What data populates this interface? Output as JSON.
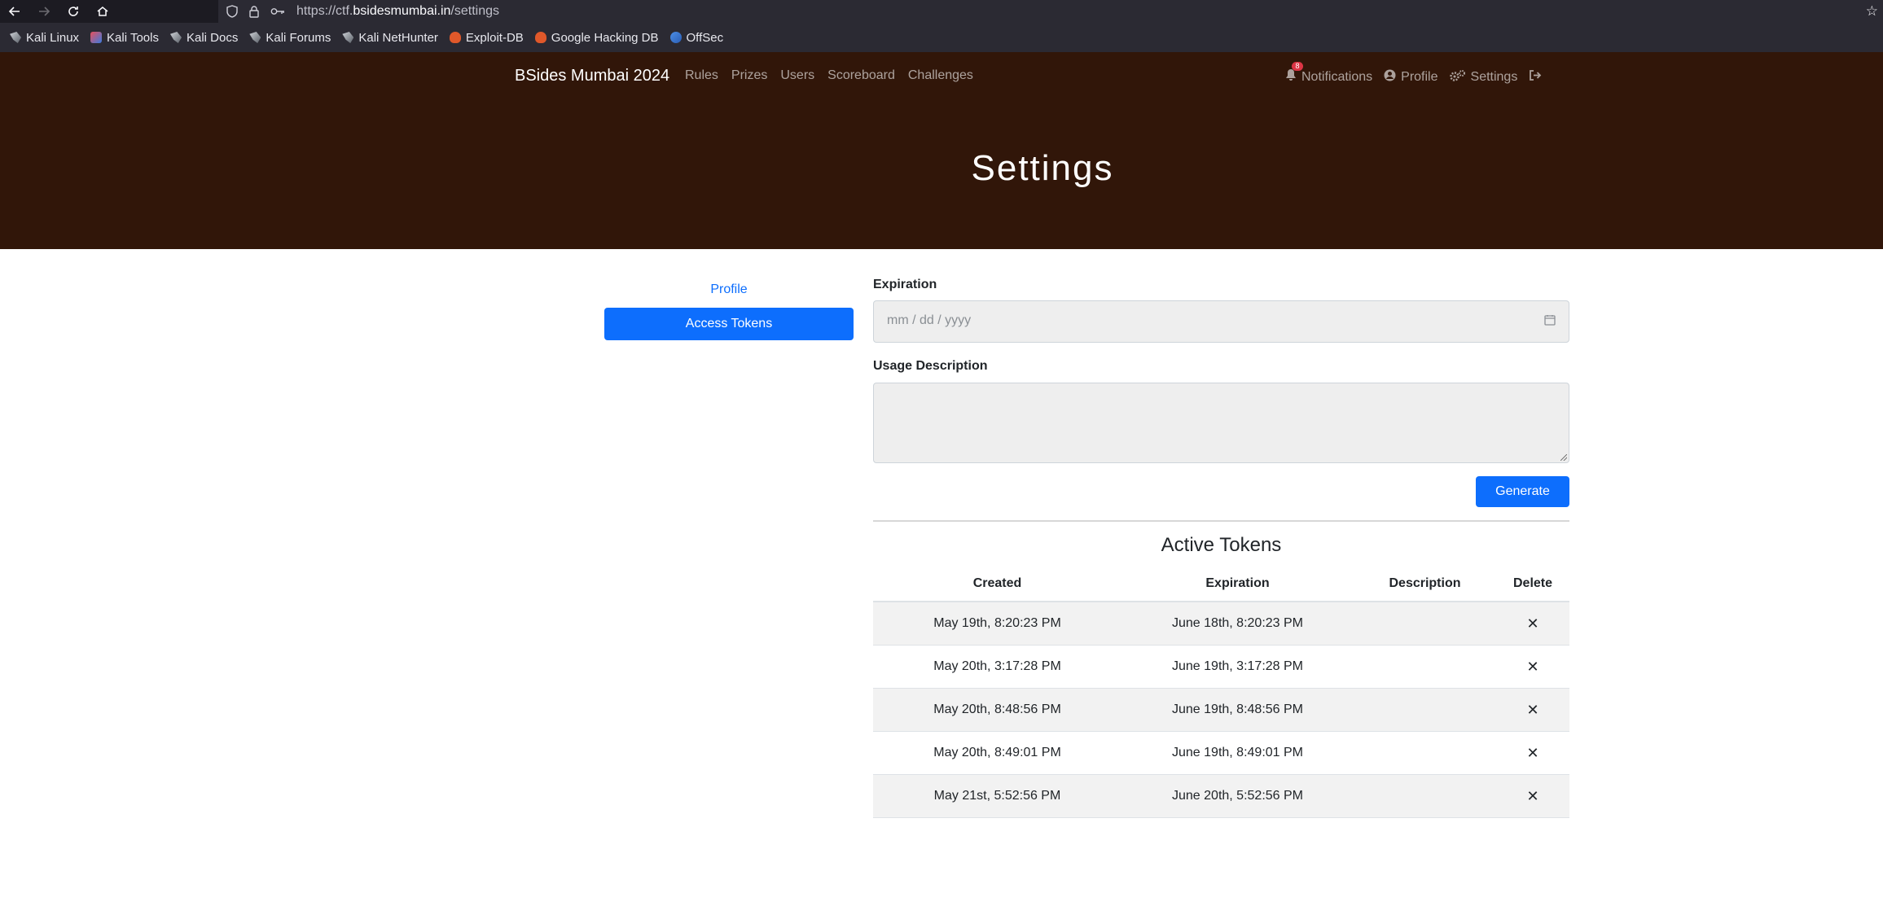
{
  "browser": {
    "url_prefix": "https://ctf.",
    "url_domain": "bsidesmumbai.in",
    "url_path": "/settings",
    "bookmarks": [
      {
        "label": "Kali Linux",
        "icon": "kali-dragon-icon"
      },
      {
        "label": "Kali Tools",
        "icon": "kali-tools-icon"
      },
      {
        "label": "Kali Docs",
        "icon": "kali-dragon-icon"
      },
      {
        "label": "Kali Forums",
        "icon": "kali-dragon-icon"
      },
      {
        "label": "Kali NetHunter",
        "icon": "kali-dragon-icon"
      },
      {
        "label": "Exploit-DB",
        "icon": "exploit-db-icon"
      },
      {
        "label": "Google Hacking DB",
        "icon": "exploit-db-icon"
      },
      {
        "label": "OffSec",
        "icon": "offsec-icon"
      }
    ]
  },
  "nav": {
    "brand": "BSides Mumbai 2024",
    "links": [
      "Rules",
      "Prizes",
      "Users",
      "Scoreboard",
      "Challenges"
    ],
    "notifications_label": "Notifications",
    "notifications_count": "8",
    "profile_label": "Profile",
    "settings_label": "Settings"
  },
  "hero": {
    "title": "Settings"
  },
  "sidebar": {
    "profile_link": "Profile",
    "access_tokens": "Access Tokens"
  },
  "form": {
    "expiration_label": "Expiration",
    "expiration_placeholder": "mm / dd / yyyy",
    "description_label": "Usage Description",
    "generate_label": "Generate"
  },
  "tokens": {
    "title": "Active Tokens",
    "headers": [
      "Created",
      "Expiration",
      "Description",
      "Delete"
    ],
    "rows": [
      {
        "created": "May 19th, 8:20:23 PM",
        "expiration": "June 18th, 8:20:23 PM",
        "description": "",
        "delete": "✕"
      },
      {
        "created": "May 20th, 3:17:28 PM",
        "expiration": "June 19th, 3:17:28 PM",
        "description": "",
        "delete": "✕"
      },
      {
        "created": "May 20th, 8:48:56 PM",
        "expiration": "June 19th, 8:48:56 PM",
        "description": "",
        "delete": "✕"
      },
      {
        "created": "May 20th, 8:49:01 PM",
        "expiration": "June 19th, 8:49:01 PM",
        "description": "",
        "delete": "✕"
      },
      {
        "created": "May 21st, 5:52:56 PM",
        "expiration": "June 20th, 5:52:56 PM",
        "description": "",
        "delete": "✕"
      }
    ]
  },
  "colors": {
    "navbar_bg": "#311609",
    "primary": "#0d6efd",
    "badge": "#dc3545"
  }
}
